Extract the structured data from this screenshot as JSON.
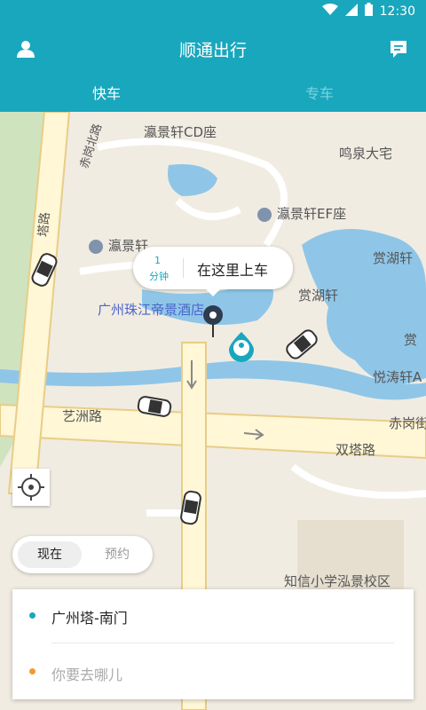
{
  "status_bar": {
    "time": "12:30"
  },
  "header": {
    "title": "顺通出行"
  },
  "tabs": [
    {
      "label": "快车",
      "active": true
    },
    {
      "label": "专车",
      "active": false
    }
  ],
  "map": {
    "labels": {
      "cd": "瀛景轩CD座",
      "mingquan": "鸣泉大宅",
      "ef": "瀛景轩EF座",
      "yingjing": "瀛景轩",
      "shanghuxuan": "赏湖轩",
      "shanghu": "赏湖轩",
      "shanghu_e": "赏湖轩",
      "hotel": "广州珠江帝景酒店",
      "shang": "赏",
      "yuetao": "悦涛轩A",
      "chigang": "赤岗街",
      "yizhou": "艺洲路",
      "shuangta": "双塔路",
      "school": "知信小学泓景校区",
      "chigang_north": "赤岗北路",
      "tower_road": "塔路"
    }
  },
  "pickup": {
    "eta_value": "1",
    "eta_unit": "分钟",
    "label": "在这里上车"
  },
  "time_toggle": {
    "now": "现在",
    "book": "预约"
  },
  "route": {
    "origin": "广州塔-南门",
    "destination_placeholder": "你要去哪儿"
  },
  "colors": {
    "primary": "#19a7bd",
    "origin_dot": "#19a7bd",
    "destination_dot": "#f39a2e"
  }
}
